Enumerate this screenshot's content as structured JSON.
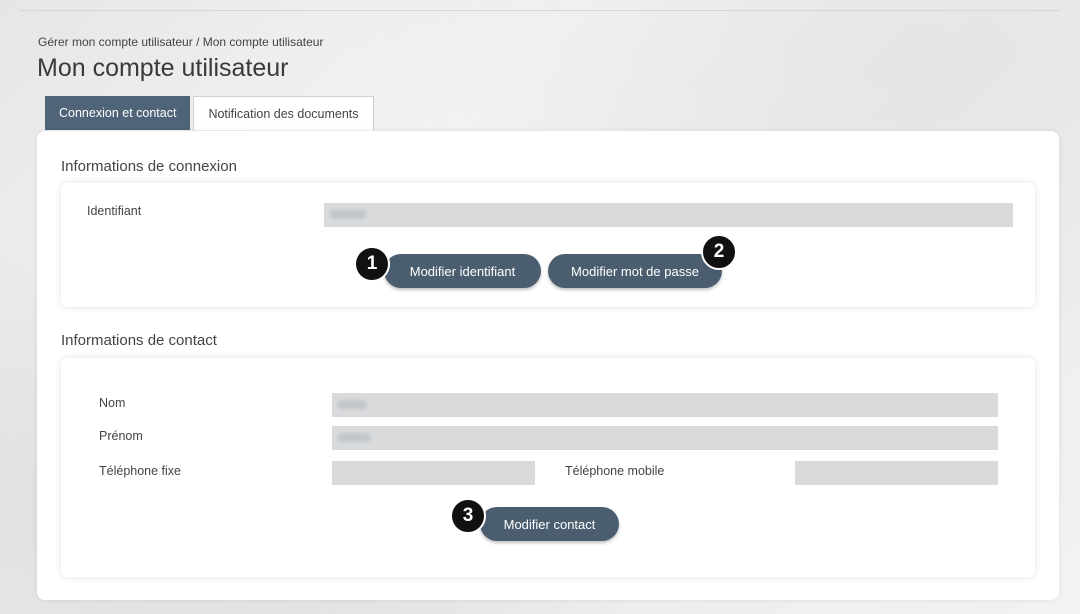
{
  "breadcrumb": "Gérer mon compte utilisateur / Mon compte utilisateur",
  "page_title": "Mon compte utilisateur",
  "tabs": [
    {
      "label": "Connexion et contact",
      "active": true
    },
    {
      "label": "Notification des documents",
      "active": false
    }
  ],
  "login_section": {
    "title": "Informations de connexion",
    "identifiant_label": "Identifiant",
    "modify_id_button": "Modifier identifiant",
    "modify_password_button": "Modifier mot de passe"
  },
  "contact_section": {
    "title": "Informations de contact",
    "nom_label": "Nom",
    "prenom_label": "Prénom",
    "tel_fixe_label": "Téléphone fixe",
    "tel_mobile_label": "Téléphone mobile",
    "modify_contact_button": "Modifier contact"
  },
  "badges": [
    "1",
    "2",
    "3"
  ],
  "colors": {
    "accent": "#4a5e70",
    "tab_active": "#4f6478",
    "input_bg": "#d8dadc",
    "badge": "#111111"
  }
}
